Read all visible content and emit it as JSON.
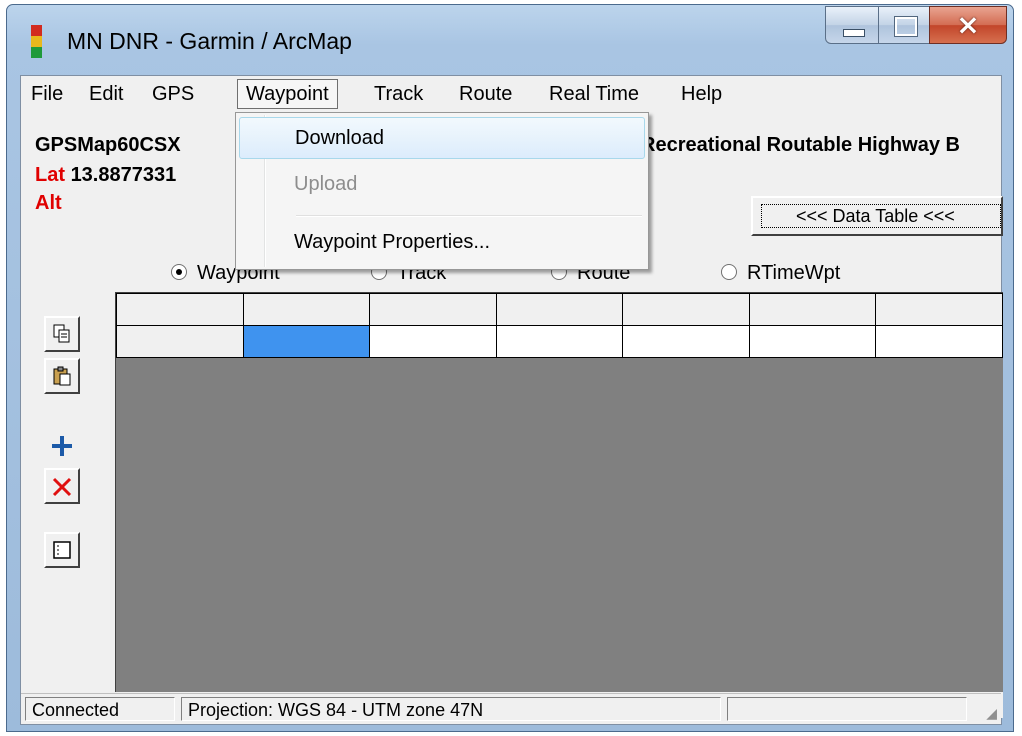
{
  "window": {
    "title": "MN DNR - Garmin / ArcMap"
  },
  "menubar": {
    "items": [
      "File",
      "Edit",
      "GPS",
      "Waypoint",
      "Track",
      "Route",
      "Real Time",
      "Help"
    ],
    "open_item": "Waypoint"
  },
  "waypoint_menu": {
    "download": "Download",
    "upload": "Upload",
    "properties": "Waypoint Properties..."
  },
  "info": {
    "model": "GPSMap60CSX",
    "basemap": "Recreational Routable Highway B",
    "lat_label": "Lat",
    "lat_value": "13.8877331",
    "alt_label": "Alt"
  },
  "data_table_button": "<<< Data Table <<<",
  "radios": {
    "waypoint": "Waypoint",
    "track": "Track",
    "route": "Route",
    "rtimewpt": "RTimeWpt",
    "selected": "waypoint"
  },
  "status": {
    "connection": "Connected",
    "projection": "Projection: WGS 84 - UTM zone 47N",
    "extra": ""
  },
  "colors": {
    "selected_cell": "#3f93ef",
    "label_red": "#e00000"
  },
  "icons": {
    "copy": "copy-icon",
    "paste": "paste-icon",
    "add": "plus-icon",
    "delete": "delete-x-icon",
    "properties": "properties-icon"
  }
}
